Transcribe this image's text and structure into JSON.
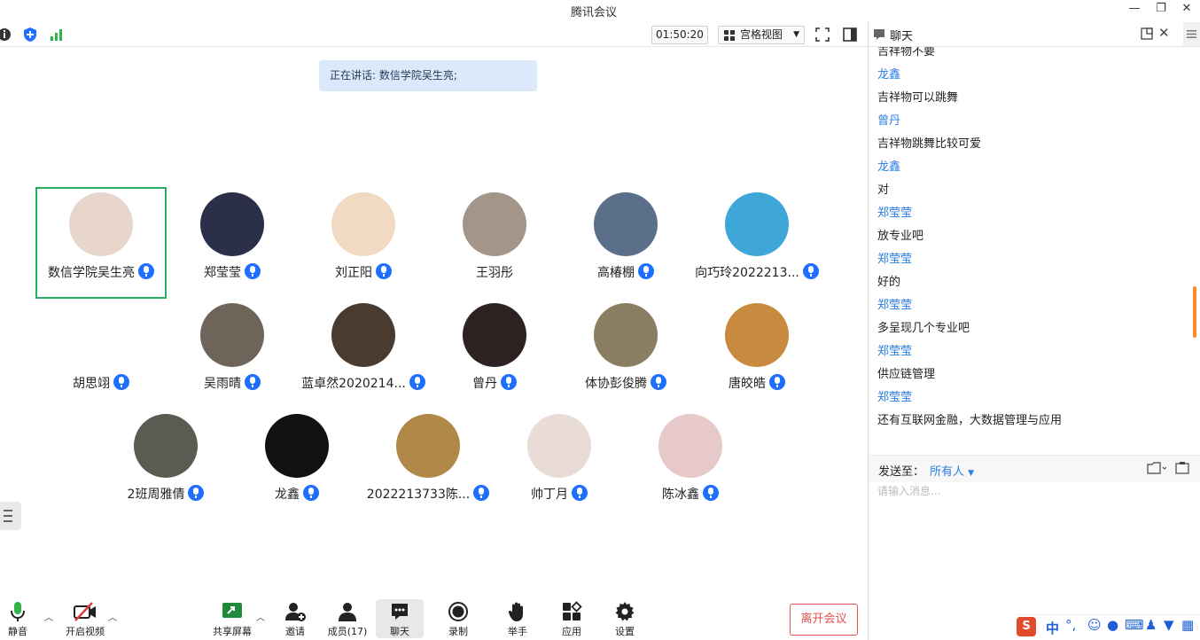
{
  "app": {
    "title": "腾讯会议"
  },
  "toolbar_top": {
    "timer": "01:50:20",
    "view_mode": "宫格视图"
  },
  "speaking": {
    "text": "正在讲话: 数信学院吴生亮;"
  },
  "participants": [
    {
      "name": "数信学院吴生亮",
      "mic": true,
      "active": true,
      "avatar_color": "#e8d6cc"
    },
    {
      "name": "郑莹莹",
      "mic": true,
      "avatar_color": "#2b2f4a"
    },
    {
      "name": "刘正阳",
      "mic": true,
      "avatar_color": "#f1d9c2"
    },
    {
      "name": "王羽彤",
      "mic": false,
      "avatar_color": "#a39588"
    },
    {
      "name": "高椿棚",
      "mic": true,
      "avatar_color": "#5b6f8a"
    },
    {
      "name": "向巧玲2022213...",
      "mic": true,
      "avatar_color": "#3fa6d8"
    },
    {
      "name": "胡思翊",
      "mic": true,
      "avatar_color": "#ffffff"
    },
    {
      "name": "吴雨晴",
      "mic": true,
      "avatar_color": "#6e645a"
    },
    {
      "name": "蓝卓然2020214...",
      "mic": true,
      "avatar_color": "#4a3b31"
    },
    {
      "name": "曾丹",
      "mic": true,
      "avatar_color": "#2c2222"
    },
    {
      "name": "体协彭俊腾",
      "mic": true,
      "avatar_color": "#8b7d62"
    },
    {
      "name": "唐皎皓",
      "mic": true,
      "avatar_color": "#c88a3f"
    },
    {
      "name": "2班周雅倩",
      "mic": true,
      "avatar_color": "#5a5c52"
    },
    {
      "name": "龙鑫",
      "mic": true,
      "avatar_color": "#111111"
    },
    {
      "name": "2022213733陈...",
      "mic": true,
      "avatar_color": "#b08848"
    },
    {
      "name": "帅丁月",
      "mic": true,
      "avatar_color": "#e9dcd6"
    },
    {
      "name": "陈冰鑫",
      "mic": true,
      "avatar_color": "#e7c9c9"
    }
  ],
  "bottom_toolbar": {
    "mute": "静音",
    "video": "开启视频",
    "share": "共享屏幕",
    "invite": "邀请",
    "members": "成员(17)",
    "chat": "聊天",
    "record": "录制",
    "raise_hand": "举手",
    "apps": "应用",
    "settings": "设置",
    "leave": "离开会议"
  },
  "chat": {
    "title": "聊天",
    "messages": [
      {
        "type": "text",
        "text": "吉祥物不要"
      },
      {
        "type": "sender",
        "text": "龙鑫"
      },
      {
        "type": "text",
        "text": "吉祥物可以跳舞"
      },
      {
        "type": "sender",
        "text": "曾丹"
      },
      {
        "type": "text",
        "text": "吉祥物跳舞比较可爱"
      },
      {
        "type": "sender",
        "text": "龙鑫"
      },
      {
        "type": "text",
        "text": "对"
      },
      {
        "type": "sender",
        "text": "郑莹莹"
      },
      {
        "type": "text",
        "text": "放专业吧"
      },
      {
        "type": "sender",
        "text": "郑莹莹"
      },
      {
        "type": "text",
        "text": "好的"
      },
      {
        "type": "sender",
        "text": "郑莹莹"
      },
      {
        "type": "text",
        "text": "多呈现几个专业吧"
      },
      {
        "type": "sender",
        "text": "郑莹莹"
      },
      {
        "type": "text",
        "text": "供应链管理"
      },
      {
        "type": "sender",
        "text": "郑莹莹"
      },
      {
        "type": "text",
        "text": "还有互联网金融，大数据管理与应用"
      }
    ],
    "send_to_label": "发送至：",
    "send_to_value": "所有人",
    "input_placeholder": "请输入消息..."
  },
  "ime": {
    "mode": "中"
  },
  "colors": {
    "accent": "#1e6fff",
    "active_border": "#27ae60",
    "leave": "#e15252",
    "sender": "#2a7ee4"
  }
}
